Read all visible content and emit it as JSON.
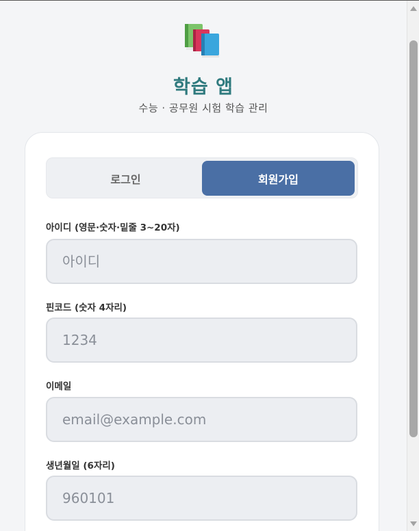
{
  "header": {
    "logo_icon": "books-icon",
    "title": "학습 앱",
    "subtitle": "수능 · 공무원 시험 학습 관리"
  },
  "tabs": {
    "login": "로그인",
    "signup": "회원가입",
    "active": "signup"
  },
  "form": {
    "id_label": "아이디 (영문·숫자·밑줄 3~20자)",
    "id_placeholder": "아이디",
    "pin_label": "핀코드 (숫자 4자리)",
    "pin_placeholder": "1234",
    "email_label": "이메일",
    "email_placeholder": "email@example.com",
    "birth_label": "생년월일 (6자리)",
    "birth_placeholder": "960101"
  },
  "colors": {
    "accent": "#4a6fa5",
    "title": "#2f7a7e"
  }
}
